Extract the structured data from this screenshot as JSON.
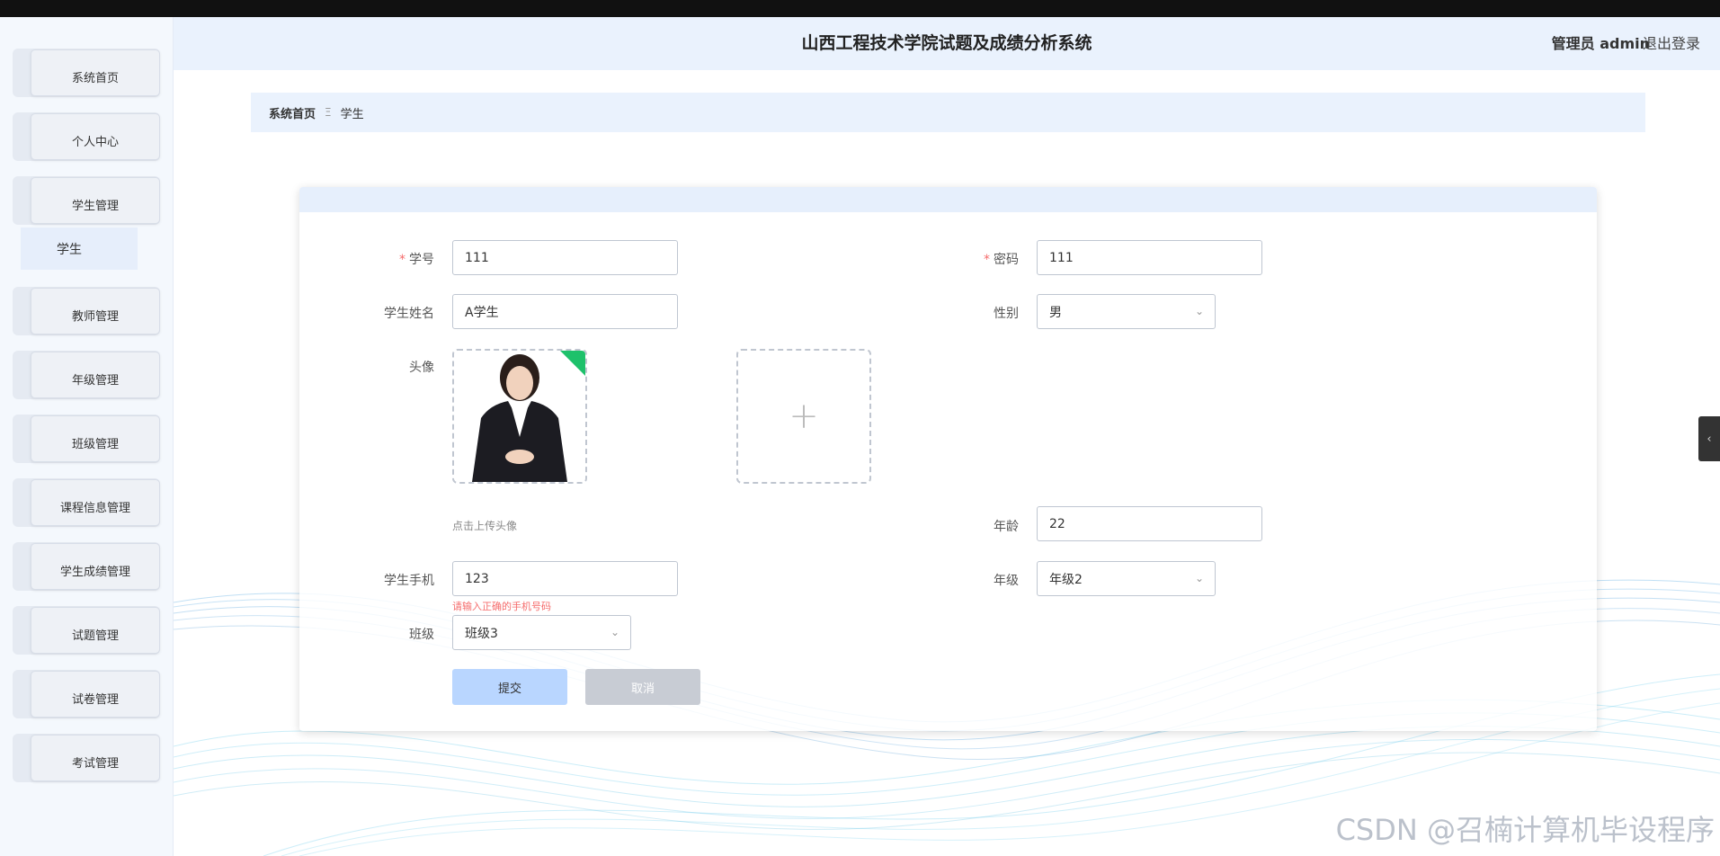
{
  "header": {
    "title": "山西工程技术学院试题及成绩分析系统",
    "user": "管理员 admin",
    "logout": "退出登录"
  },
  "sidebar": {
    "items": [
      {
        "label": "系统首页"
      },
      {
        "label": "个人中心"
      },
      {
        "label": "学生管理"
      },
      {
        "label": "教师管理"
      },
      {
        "label": "年级管理"
      },
      {
        "label": "班级管理"
      },
      {
        "label": "课程信息管理"
      },
      {
        "label": "学生成绩管理"
      },
      {
        "label": "试题管理"
      },
      {
        "label": "试卷管理"
      },
      {
        "label": "考试管理"
      }
    ],
    "submenu": {
      "label": "学生"
    }
  },
  "breadcrumb": {
    "home": "系统首页",
    "separator": "Ξ",
    "current": "学生"
  },
  "form": {
    "student_no": {
      "label": "学号",
      "value": "111"
    },
    "password": {
      "label": "密码",
      "value": "111"
    },
    "student_name": {
      "label": "学生姓名",
      "value": "A学生"
    },
    "gender": {
      "label": "性别",
      "value": "男"
    },
    "avatar": {
      "label": "头像",
      "hint": "点击上传头像"
    },
    "age": {
      "label": "年龄",
      "value": "22"
    },
    "phone": {
      "label": "学生手机",
      "value": "123",
      "error": "请输入正确的手机号码"
    },
    "grade": {
      "label": "年级",
      "value": "年级2"
    },
    "class": {
      "label": "班级",
      "value": "班级3"
    },
    "submit_label": "提交",
    "cancel_label": "取消"
  },
  "watermark": "CSDN @召楠计算机毕设程序",
  "colors": {
    "accent_bg": "#eaf2fd",
    "required": "#f56c6c",
    "submit": "#b9d6ff",
    "cancel": "#c8ccd4"
  }
}
